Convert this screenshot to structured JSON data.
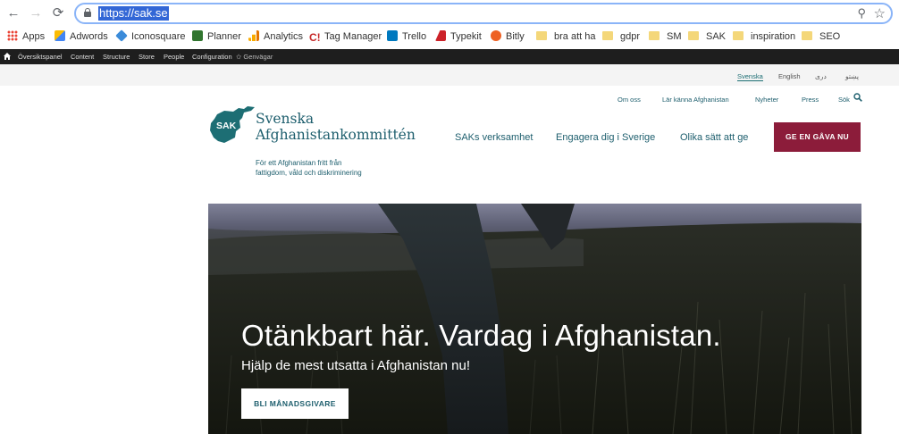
{
  "browser": {
    "url": "https://sak.se",
    "back_glyph": "←",
    "forward_glyph": "→",
    "reload_glyph": "⟳",
    "zoom_glyph": "⚲",
    "star_glyph": "☆",
    "bookmarks": [
      {
        "label": "Apps",
        "icon": "apps-grid-icon"
      },
      {
        "label": "Adwords",
        "icon": "adwords-icon",
        "color": "#4285f4"
      },
      {
        "label": "Iconosquare",
        "icon": "iconosquare-icon",
        "color": "#3b8bd9"
      },
      {
        "label": "Planner",
        "icon": "planner-icon",
        "color": "#31752f"
      },
      {
        "label": "Analytics",
        "icon": "analytics-icon",
        "color": "#f9ab00"
      },
      {
        "label": "Tag Manager",
        "icon": "tag-manager-icon",
        "color": "#c62828"
      },
      {
        "label": "Trello",
        "icon": "trello-icon",
        "color": "#0079bf"
      },
      {
        "label": "Typekit",
        "icon": "typekit-icon",
        "color": "#cc2229"
      },
      {
        "label": "Bitly",
        "icon": "bitly-icon",
        "color": "#ee6123"
      },
      {
        "label": "bra att ha",
        "icon": "folder-icon"
      },
      {
        "label": "gdpr",
        "icon": "folder-icon"
      },
      {
        "label": "SM",
        "icon": "folder-icon"
      },
      {
        "label": "SAK",
        "icon": "folder-icon"
      },
      {
        "label": "inspiration",
        "icon": "folder-icon"
      },
      {
        "label": "SEO",
        "icon": "folder-icon"
      }
    ]
  },
  "admin_toolbar": {
    "items": [
      "Översiktspanel",
      "Content",
      "Structure",
      "Store",
      "People",
      "Configuration",
      "Genvägar"
    ]
  },
  "languages": [
    "Svenska",
    "English",
    "دری",
    "پښتو"
  ],
  "site": {
    "utility_nav": [
      "Om oss",
      "Lär känna Afghanistan",
      "Nyheter",
      "Press",
      "Sök"
    ],
    "logo_text": "SAK",
    "org_name_line1": "Svenska",
    "org_name_line2": "Afghanistankommittén",
    "tagline_line1": "För ett Afghanistan fritt från",
    "tagline_line2": "fattigdom, våld och diskriminering",
    "main_nav": [
      "SAKs verksamhet",
      "Engagera dig i Sverige",
      "Olika sätt att ge"
    ],
    "cta": "GE EN GÅVA NU",
    "brand_color": "#1d5e6d",
    "cta_color": "#8c1c3a"
  },
  "hero": {
    "title": "Otänkbart här. Vardag i Afghanistan.",
    "subtitle": "Hjälp de mest utsatta i Afghanistan nu!",
    "button": "BLI MÅNADSGIVARE"
  }
}
